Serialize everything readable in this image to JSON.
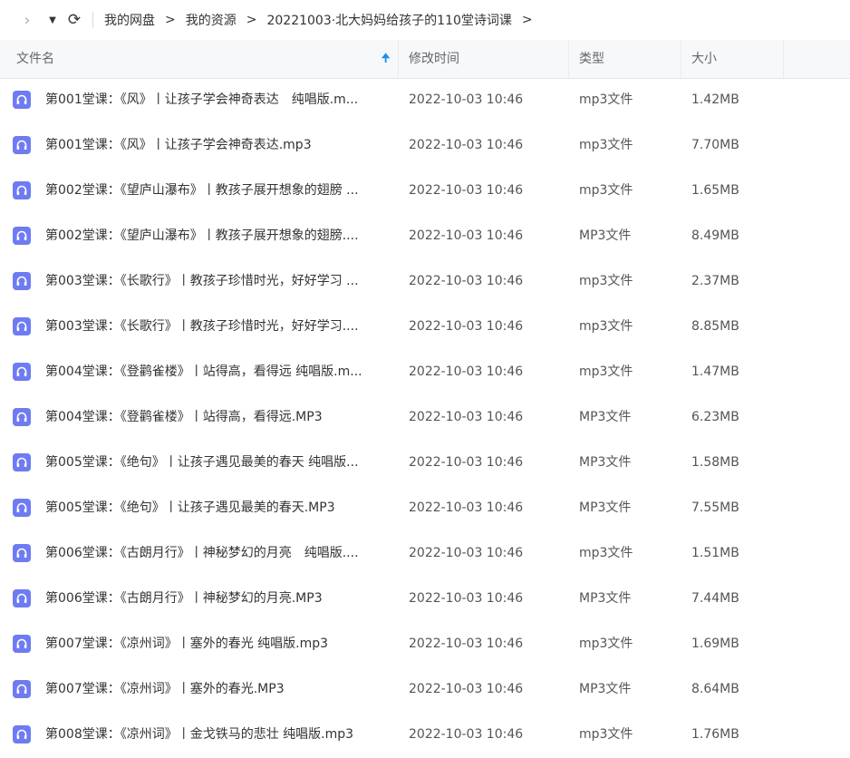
{
  "toolbar": {
    "breadcrumbs": [
      "我的网盘",
      "我的资源",
      "20221003·北大妈妈给孩子的110堂诗词课"
    ],
    "separator": ">",
    "icons": {
      "forward": "chevron-right-icon",
      "dropdown": "caret-down-icon",
      "refresh": "refresh-icon"
    }
  },
  "table": {
    "columns": {
      "name": "文件名",
      "time": "修改时间",
      "type": "类型",
      "size": "大小"
    },
    "sort": "name-ascending",
    "file_icon": "audio-file-icon",
    "icon_color": "#6e7bf2",
    "rows": [
      {
        "name": "第001堂课：《风》丨让孩子学会神奇表达　纯唱版.m...",
        "time": "2022-10-03 10:46",
        "type": "mp3文件",
        "size": "1.42MB"
      },
      {
        "name": "第001堂课：《风》丨让孩子学会神奇表达.mp3",
        "time": "2022-10-03 10:46",
        "type": "mp3文件",
        "size": "7.70MB"
      },
      {
        "name": "第002堂课：《望庐山瀑布》丨教孩子展开想象的翅膀 ...",
        "time": "2022-10-03 10:46",
        "type": "mp3文件",
        "size": "1.65MB"
      },
      {
        "name": "第002堂课：《望庐山瀑布》丨教孩子展开想象的翅膀....",
        "time": "2022-10-03 10:46",
        "type": "MP3文件",
        "size": "8.49MB"
      },
      {
        "name": "第003堂课：《长歌行》丨教孩子珍惜时光，好好学习 ...",
        "time": "2022-10-03 10:46",
        "type": "mp3文件",
        "size": "2.37MB"
      },
      {
        "name": "第003堂课：《长歌行》丨教孩子珍惜时光，好好学习....",
        "time": "2022-10-03 10:46",
        "type": "mp3文件",
        "size": "8.85MB"
      },
      {
        "name": "第004堂课：《登鹳雀楼》丨站得高，看得远 纯唱版.m...",
        "time": "2022-10-03 10:46",
        "type": "mp3文件",
        "size": "1.47MB"
      },
      {
        "name": "第004堂课：《登鹳雀楼》丨站得高，看得远.MP3",
        "time": "2022-10-03 10:46",
        "type": "MP3文件",
        "size": "6.23MB"
      },
      {
        "name": "第005堂课：《绝句》丨让孩子遇见最美的春天 纯唱版...",
        "time": "2022-10-03 10:46",
        "type": "MP3文件",
        "size": "1.58MB"
      },
      {
        "name": "第005堂课：《绝句》丨让孩子遇见最美的春天.MP3",
        "time": "2022-10-03 10:46",
        "type": "MP3文件",
        "size": "7.55MB"
      },
      {
        "name": "第006堂课：《古朗月行》丨神秘梦幻的月亮　纯唱版....",
        "time": "2022-10-03 10:46",
        "type": "mp3文件",
        "size": "1.51MB"
      },
      {
        "name": "第006堂课：《古朗月行》丨神秘梦幻的月亮.MP3",
        "time": "2022-10-03 10:46",
        "type": "MP3文件",
        "size": "7.44MB"
      },
      {
        "name": "第007堂课：《凉州词》丨塞外的春光 纯唱版.mp3",
        "time": "2022-10-03 10:46",
        "type": "mp3文件",
        "size": "1.69MB"
      },
      {
        "name": "第007堂课：《凉州词》丨塞外的春光.MP3",
        "time": "2022-10-03 10:46",
        "type": "MP3文件",
        "size": "8.64MB"
      },
      {
        "name": "第008堂课：《凉州词》丨金戈铁马的悲壮 纯唱版.mp3",
        "time": "2022-10-03 10:46",
        "type": "mp3文件",
        "size": "1.76MB"
      }
    ]
  }
}
